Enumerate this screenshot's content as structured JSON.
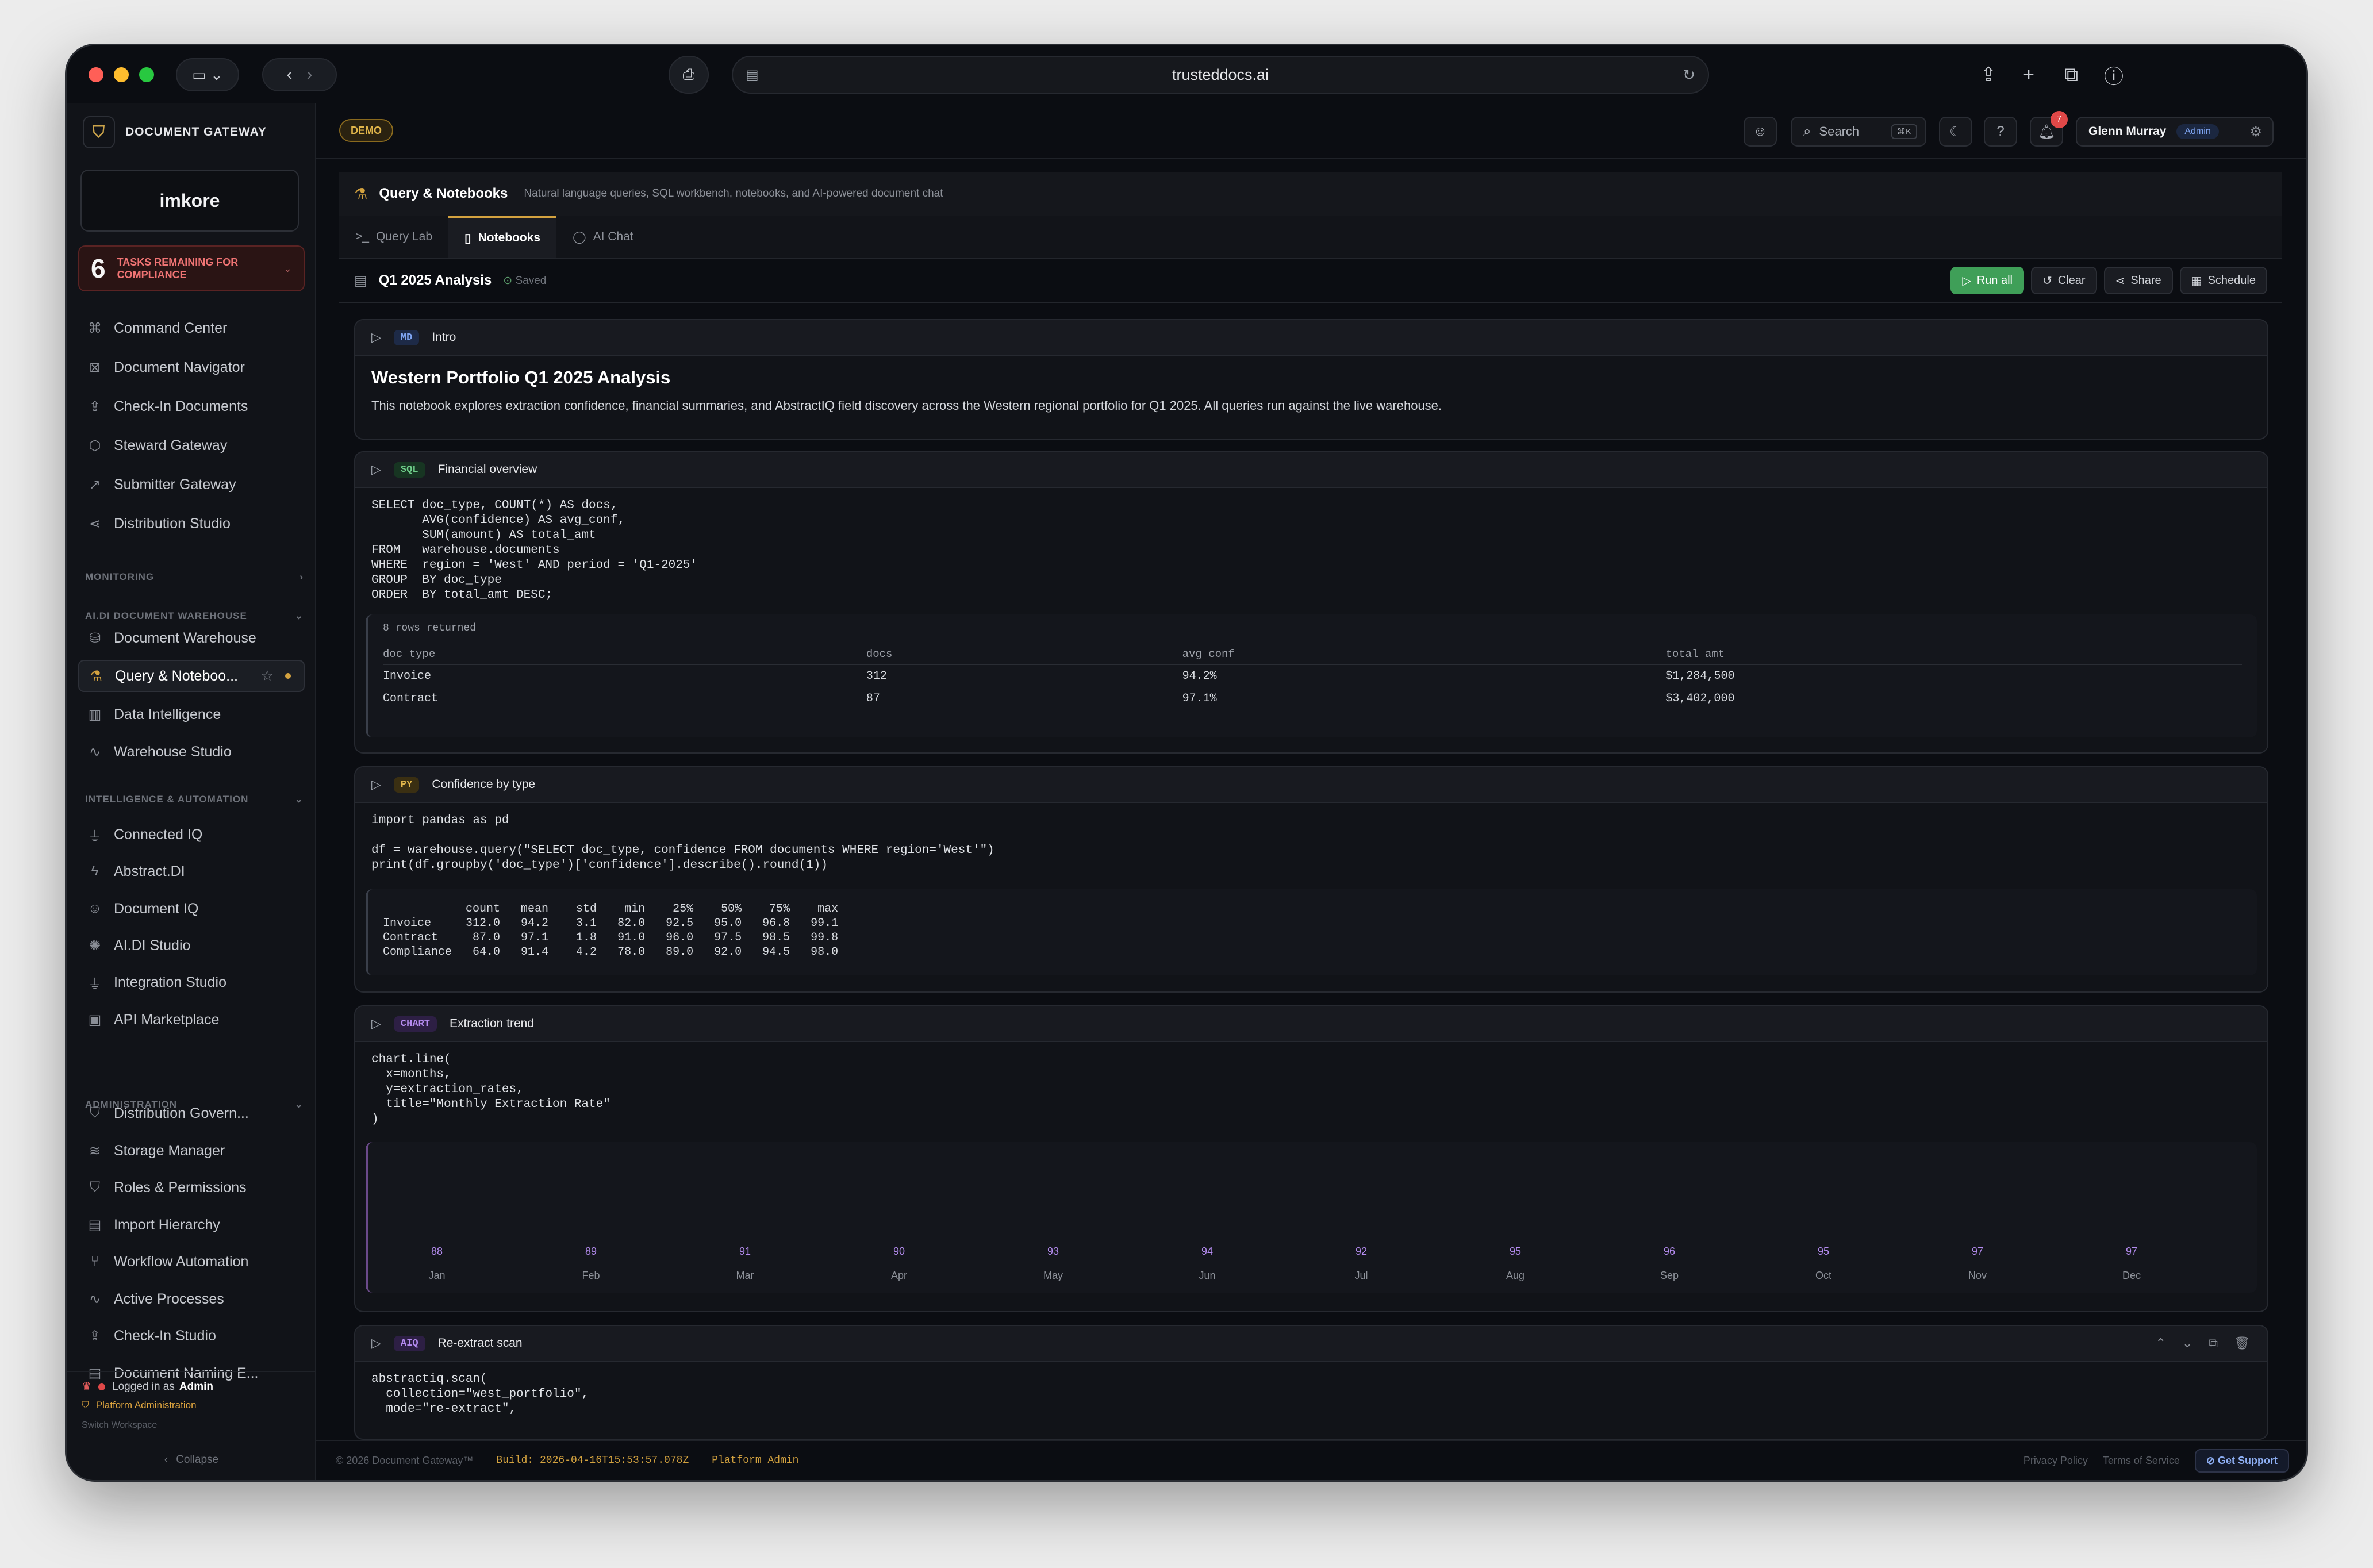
{
  "browser": {
    "url": "trusteddocs.ai"
  },
  "sidebar": {
    "brand": "DOCUMENT GATEWAY",
    "logo_text": "imkore",
    "tasks": {
      "count": "6",
      "label": "TASKS REMAINING FOR COMPLIANCE"
    },
    "top_items": [
      {
        "label": "Command Center",
        "icon": "command-icon"
      },
      {
        "label": "Document Navigator",
        "icon": "navigator-icon"
      },
      {
        "label": "Check-In Documents",
        "icon": "upload-icon"
      },
      {
        "label": "Steward Gateway",
        "icon": "cube-icon"
      },
      {
        "label": "Submitter Gateway",
        "icon": "external-link-icon"
      },
      {
        "label": "Distribution Studio",
        "icon": "share-icon"
      }
    ],
    "sec_monitoring": "MONITORING",
    "sec_warehouse": "AI.DI DOCUMENT WAREHOUSE",
    "warehouse_items": [
      {
        "label": "Document Warehouse",
        "icon": "database-icon"
      },
      {
        "label": "Query & Noteboo...",
        "icon": "flask-icon"
      },
      {
        "label": "Data Intelligence",
        "icon": "bar-chart-icon"
      },
      {
        "label": "Warehouse Studio",
        "icon": "activity-icon"
      }
    ],
    "sec_intel": "INTELLIGENCE & AUTOMATION",
    "intel_items": [
      {
        "label": "Connected IQ",
        "icon": "plug-icon"
      },
      {
        "label": "Abstract.DI",
        "icon": "bolt-icon"
      },
      {
        "label": "Document IQ",
        "icon": "robot-icon"
      },
      {
        "label": "AI.DI Studio",
        "icon": "brain-icon"
      },
      {
        "label": "Integration Studio",
        "icon": "plug-icon"
      },
      {
        "label": "API Marketplace",
        "icon": "store-icon"
      }
    ],
    "sec_admin": "ADMINISTRATION",
    "admin_items": [
      {
        "label": "Distribution Govern...",
        "icon": "shield-icon"
      },
      {
        "label": "Storage Manager",
        "icon": "layers-icon"
      },
      {
        "label": "Roles & Permissions",
        "icon": "shield-icon"
      },
      {
        "label": "Import Hierarchy",
        "icon": "file-icon"
      },
      {
        "label": "Workflow Automation",
        "icon": "branch-icon"
      },
      {
        "label": "Active Processes",
        "icon": "activity-icon"
      },
      {
        "label": "Check-In Studio",
        "icon": "upload-icon"
      },
      {
        "label": "Document Naming E...",
        "icon": "file-icon"
      }
    ],
    "logged_prefix": "Logged in as",
    "logged_role": "Admin",
    "platform_admin": "Platform Administration",
    "switch_workspace": "Switch Workspace",
    "collapse": "Collapse"
  },
  "header": {
    "demo": "DEMO",
    "search": "Search",
    "search_kbd": "⌘K",
    "notifications": "7",
    "user": "Glenn Murray",
    "role": "Admin"
  },
  "page": {
    "title": "Query & Notebooks",
    "subtitle": "Natural language queries, SQL workbench, notebooks, and AI-powered document chat",
    "tabs": [
      "Query Lab",
      "Notebooks",
      "AI Chat"
    ],
    "notebook_name": "Q1 2025 Analysis",
    "saved": "Saved",
    "run_all": "Run all",
    "clear": "Clear",
    "share": "Share",
    "schedule": "Schedule"
  },
  "cells": {
    "intro": {
      "type": "MD",
      "name": "Intro",
      "heading": "Western Portfolio Q1 2025 Analysis",
      "body": "This notebook explores extraction confidence, financial summaries, and AbstractIQ field discovery across the Western regional portfolio for Q1 2025. All queries run against the live warehouse."
    },
    "sql": {
      "type": "SQL",
      "name": "Financial overview",
      "code": "SELECT doc_type, COUNT(*) AS docs,\n       AVG(confidence) AS avg_conf,\n       SUM(amount) AS total_amt\nFROM   warehouse.documents\nWHERE  region = 'West' AND period = 'Q1-2025'\nGROUP  BY doc_type\nORDER  BY total_amt DESC;",
      "rows_returned": "8 rows returned",
      "columns": [
        "doc_type",
        "docs",
        "avg_conf",
        "total_amt"
      ],
      "rows": [
        [
          "Invoice",
          "312",
          "94.2%",
          "$1,284,500"
        ],
        [
          "Contract",
          "87",
          "97.1%",
          "$3,402,000"
        ]
      ]
    },
    "py": {
      "type": "PY",
      "name": "Confidence by type",
      "code": "import pandas as pd\n\ndf = warehouse.query(\"SELECT doc_type, confidence FROM documents WHERE region='West'\")\nprint(df.groupby('doc_type')['confidence'].describe().round(1))",
      "output": "            count   mean    std    min    25%    50%    75%    max\nInvoice     312.0   94.2    3.1   82.0   92.5   95.0   96.8   99.1\nContract     87.0   97.1    1.8   91.0   96.0   97.5   98.5   99.8\nCompliance   64.0   91.4    4.2   78.0   89.0   92.0   94.5   98.0"
    },
    "chart": {
      "type": "CHART",
      "name": "Extraction trend",
      "code": "chart.line(\n  x=months,\n  y=extraction_rates,\n  title=\"Monthly Extraction Rate\"\n)"
    },
    "aiq": {
      "type": "AIQ",
      "name": "Re-extract scan",
      "code": "abstractiq.scan(\n  collection=\"west_portfolio\",\n  mode=\"re-extract\","
    }
  },
  "chart_data": {
    "type": "line",
    "categories": [
      "Jan",
      "Feb",
      "Mar",
      "Apr",
      "May",
      "Jun",
      "Jul",
      "Aug",
      "Sep",
      "Oct",
      "Nov",
      "Dec"
    ],
    "values": [
      88,
      89,
      91,
      90,
      93,
      94,
      92,
      95,
      96,
      95,
      97,
      97
    ],
    "title": "",
    "xlabel": "",
    "ylabel": ""
  },
  "footer": {
    "copyright": "© 2026 Document Gateway™",
    "build": "Build: 2026-04-16T15:53:57.078Z",
    "platform": "Platform Admin",
    "privacy": "Privacy Policy",
    "terms": "Terms of Service",
    "support": "Get Support"
  },
  "colors": {
    "accent": "#d3a23f",
    "run": "#3f9f58",
    "sql": "#6fcf8a",
    "py": "#e3b84c",
    "chart": "#b58cf0",
    "aiq": "#b58cf0",
    "md": "#7ea4f0"
  }
}
